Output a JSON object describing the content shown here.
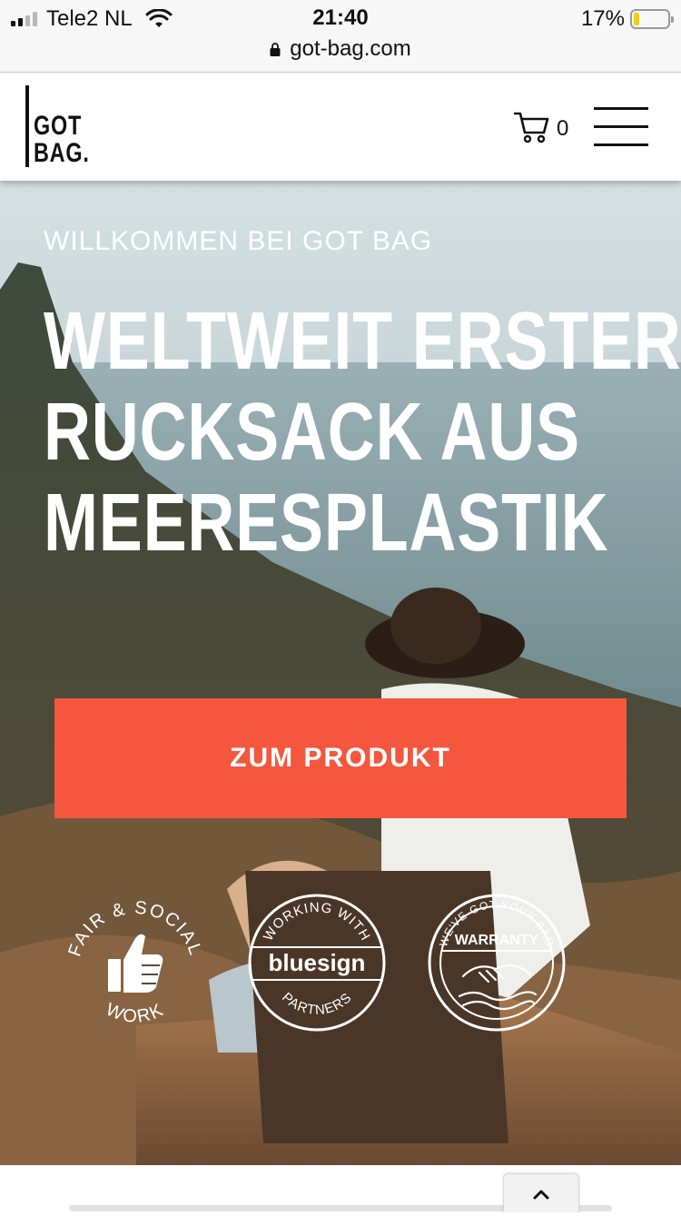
{
  "status_bar": {
    "carrier": "Tele2 NL",
    "time": "21:40",
    "battery_percent": "17%",
    "battery_level": 0.17,
    "url": "got-bag.com"
  },
  "header": {
    "logo_line1": "GOT",
    "logo_line2": "BAG.",
    "cart_count": "0"
  },
  "hero": {
    "welcome": "WILLKOMMEN BEI GOT BAG",
    "headline_lines": [
      "WELTWEIT ERSTER",
      "RUCKSACK AUS",
      "MEERESPLASTIK"
    ],
    "cta_label": "ZUM PRODUKT",
    "badges": {
      "fair": {
        "top": "FAIR & SOCIAL",
        "bottom": "WORK"
      },
      "bluesign": {
        "top": "WORKING WITH",
        "center": "bluesign",
        "bottom": "PARTNERS"
      },
      "warranty": {
        "top": "WE'VE GOT YOUR BAG",
        "center": "WARRANTY"
      }
    }
  },
  "colors": {
    "accent": "#f4573e",
    "text_on_hero": "#ffffff",
    "battery": "#f5cd00"
  },
  "icons": [
    "signal-icon",
    "wifi-icon",
    "battery-icon",
    "lock-icon",
    "cart-icon",
    "hamburger-menu-icon",
    "thumbs-up-icon",
    "handshake-icon",
    "chevron-up-icon"
  ]
}
